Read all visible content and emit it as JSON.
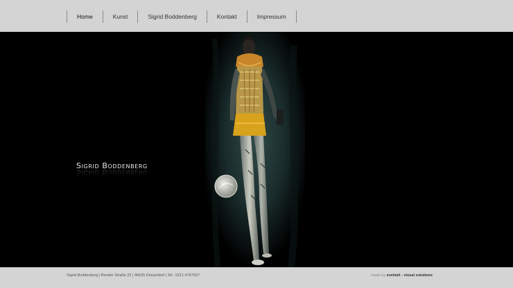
{
  "nav": {
    "items": [
      {
        "label": "Home",
        "active": true
      },
      {
        "label": "Kunst",
        "active": false
      },
      {
        "label": "Sigrid Boddenberg",
        "active": false
      },
      {
        "label": "Kontakt",
        "active": false
      },
      {
        "label": "Impressum",
        "active": false
      }
    ]
  },
  "main": {
    "brand": "Sigrid Boddenberg",
    "artwork_icon": "figure-painting-icon"
  },
  "footer": {
    "address": "Sigrid Boddenberg | Bender Straße 22 | 40625 Düsseldorf | Tel.: 0211 4797927",
    "credit_prefix": "made by",
    "credit_name": "eveliwit - visual solutions"
  },
  "colors": {
    "bar": "#d4d4d4",
    "stage": "#000000",
    "brand_text": "#e8e8e8",
    "skirt": "#d9a21c"
  }
}
